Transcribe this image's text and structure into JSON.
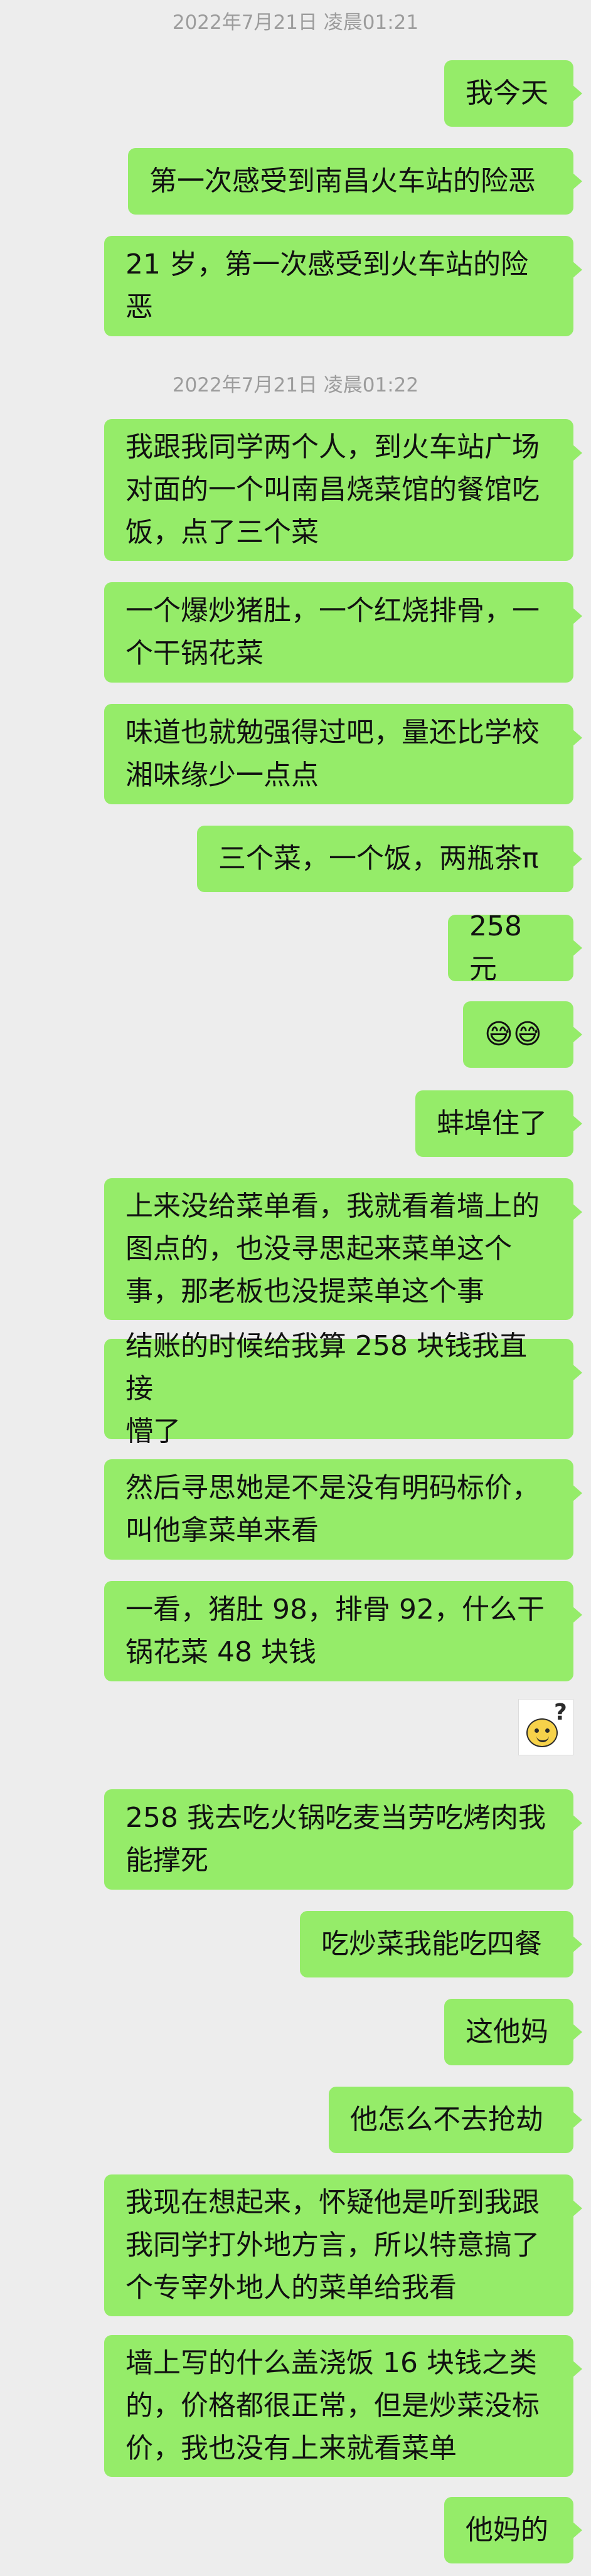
{
  "chat": {
    "timestamp_1": "2022年7月21日 凌晨01:21",
    "timestamp_2": "2022年7月21日 凌晨01:22",
    "messages": [
      "我今天",
      "第一次感受到南昌火车站的险恶",
      "21 岁，第一次感受到火车站的险\n恶",
      "我跟我同学两个人，到火车站广场\n对面的一个叫南昌烧菜馆的餐馆吃\n饭，点了三个菜",
      "一个爆炒猪肚，一个红烧排骨，一\n个干锅花菜",
      "味道也就勉强得过吧，量还比学校\n湘味缘少一点点",
      "三个菜，一个饭，两瓶茶π",
      "258 元",
      "😅😅",
      "蚌埠住了",
      "上来没给菜单看，我就看着墙上的\n图点的，也没寻思起来菜单这个\n事，那老板也没提菜单这个事",
      "结账的时候给我算 258 块钱我直接\n懵了",
      "然后寻思她是不是没有明码标价，\n叫他拿菜单来看",
      "一看，猪肚 98，排骨 92，什么干\n锅花菜 48 块钱",
      "258 我去吃火锅吃麦当劳吃烤肉我\n能撑死",
      "吃炒菜我能吃四餐",
      "这他妈",
      "他怎么不去抢劫",
      "我现在想起来，怀疑他是听到我跟\n我同学打外地方言，所以特意搞了\n个专宰外地人的菜单给我看",
      "墙上写的什么盖浇饭 16 块钱之类\n的，价格都很正常，但是炒菜没标\n价，我也没有上来就看菜单",
      "他妈的"
    ],
    "sticker_icon": "confused-face-question-sticker"
  }
}
